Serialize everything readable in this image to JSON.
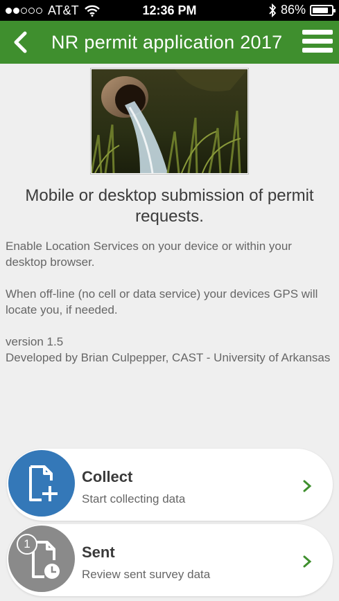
{
  "status_bar": {
    "carrier": "AT&T",
    "time": "12:36 PM",
    "battery": "86%",
    "battery_level": 0.86,
    "signal_bars_filled": 2,
    "signal_bars_total": 5
  },
  "nav": {
    "title": "NR permit application 2017"
  },
  "content": {
    "headline": "Mobile or desktop submission of permit requests.",
    "paragraph1": "Enable Location Services on your device or within your desktop browser.",
    "paragraph2": "When off-line (no cell or data service) your devices GPS will locate you, if needed.",
    "version": "version 1.5",
    "developer": "Developed by Brian Culpepper, CAST - University of Arkansas"
  },
  "actions": {
    "collect": {
      "title": "Collect",
      "subtitle": "Start collecting data",
      "icon": "new-document-icon",
      "color": "#3478b8"
    },
    "sent": {
      "title": "Sent",
      "subtitle": "Review sent survey data",
      "icon": "sent-document-clock-icon",
      "badge": "1",
      "color": "#8a8a8a"
    }
  },
  "colors": {
    "header": "#3f8f2e",
    "chevron": "#3f8f2e",
    "background": "#efefef"
  }
}
